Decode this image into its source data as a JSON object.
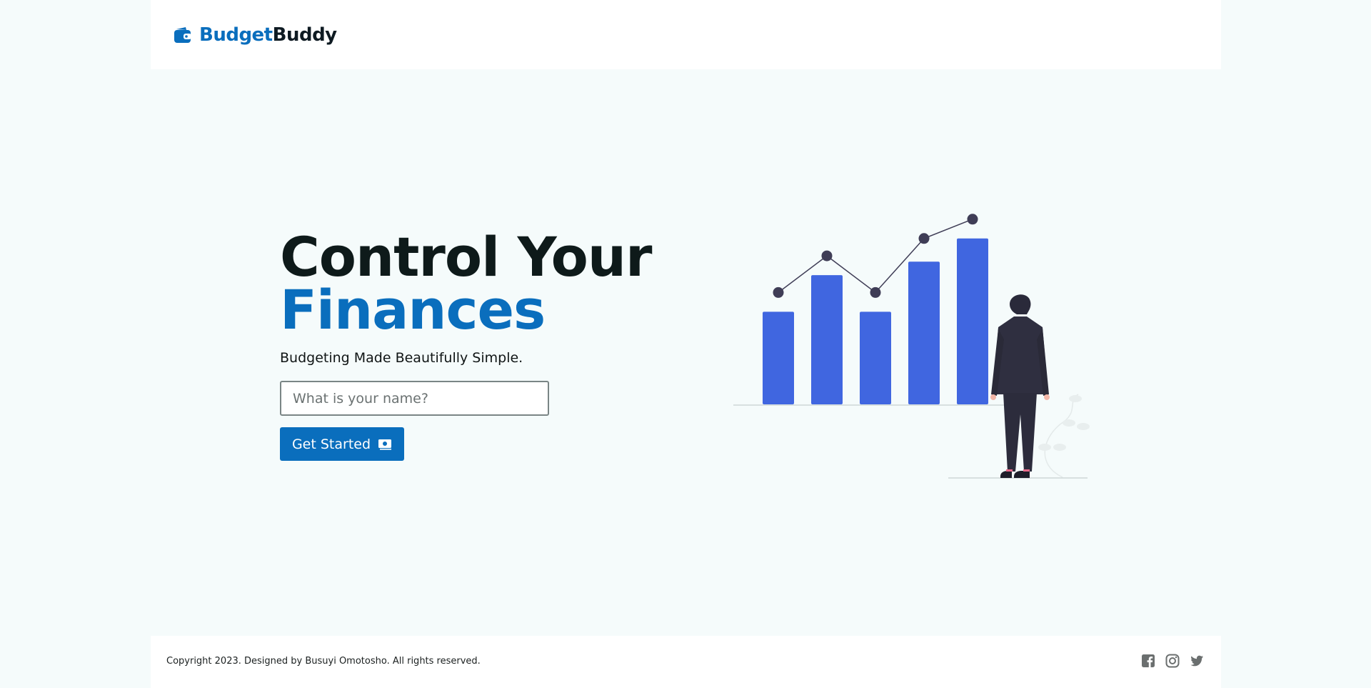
{
  "header": {
    "logo_part1": "Budget",
    "logo_part2": "Buddy",
    "logo_icon": "wallet-icon"
  },
  "hero": {
    "title_line1": "Control Your",
    "title_line2": "Finances",
    "tagline": "Budgeting Made Beautifully Simple.",
    "name_placeholder": "What is your name?",
    "name_value": "",
    "cta_label": "Get Started",
    "cta_icon": "money-bill-icon"
  },
  "illustration": {
    "bar_levels": [
      0.48,
      0.67,
      0.48,
      0.74,
      0.86
    ],
    "trend_points": [
      0.58,
      0.77,
      0.58,
      0.86,
      0.96
    ]
  },
  "footer": {
    "copyright": "Copyright 2023. Designed by Busuyi Omotosho. All rights reserved.",
    "social_icons": [
      "facebook-icon",
      "instagram-icon",
      "twitter-icon"
    ]
  },
  "colors": {
    "brand_blue": "#0a6ebd",
    "bar_blue": "#4066e0",
    "dark": "#0e1a1a",
    "page_bg": "#f5fbfb"
  }
}
